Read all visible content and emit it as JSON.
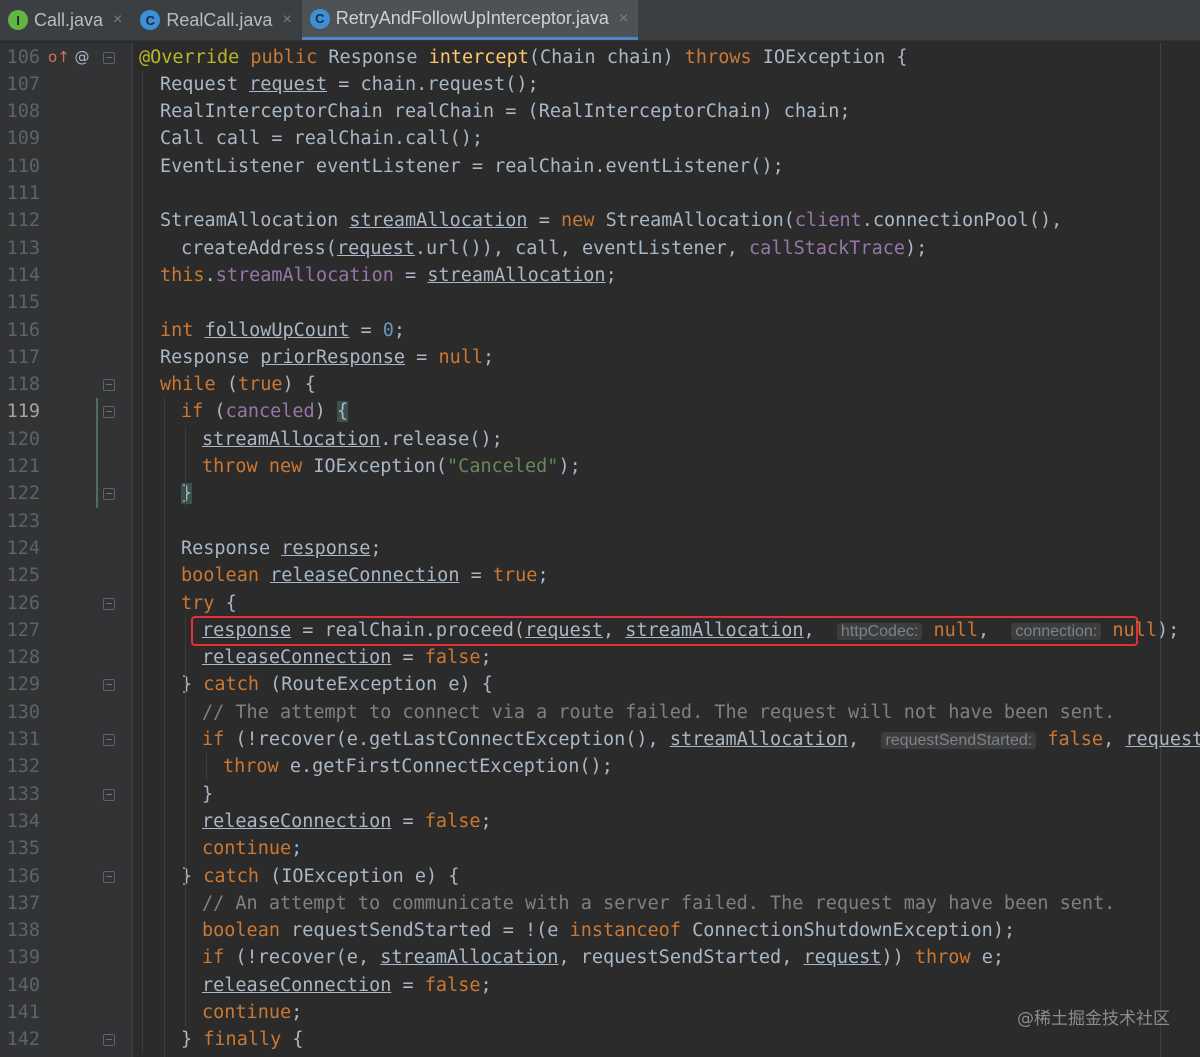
{
  "tabs": [
    {
      "label": "Call.java",
      "icon": "interface-icon",
      "glyph": "I",
      "active": false
    },
    {
      "label": "RealCall.java",
      "icon": "class-icon",
      "glyph": "C",
      "active": false
    },
    {
      "label": "RetryAndFollowUpInterceptor.java",
      "icon": "class-icon",
      "glyph": "C",
      "active": true
    }
  ],
  "tab_close_glyph": "×",
  "current_line": "119",
  "watermark": "@稀土掘金技术社区",
  "highlight_color": "#e5303a",
  "lines": [
    {
      "n": "106",
      "indent": 1,
      "code": [
        [
          "ann",
          "@Override "
        ],
        [
          "kw",
          "public "
        ],
        [
          "",
          "Response "
        ],
        [
          "fn",
          "intercept"
        ],
        [
          "",
          "(Chain chain) "
        ],
        [
          "kw",
          "throws "
        ],
        [
          "",
          "IOException {"
        ]
      ]
    },
    {
      "n": "107",
      "indent": 2,
      "code": [
        [
          "",
          "Request "
        ],
        [
          "u",
          "request"
        ],
        [
          "",
          " = chain.request();"
        ]
      ]
    },
    {
      "n": "108",
      "indent": 2,
      "code": [
        [
          "",
          "RealInterceptorChain realChain = (RealInterceptorChain) chain;"
        ]
      ]
    },
    {
      "n": "109",
      "indent": 2,
      "code": [
        [
          "",
          "Call call = realChain.call();"
        ]
      ]
    },
    {
      "n": "110",
      "indent": 2,
      "code": [
        [
          "",
          "EventListener eventListener = realChain.eventListener();"
        ]
      ]
    },
    {
      "n": "111",
      "indent": 2,
      "code": []
    },
    {
      "n": "112",
      "indent": 2,
      "code": [
        [
          "",
          "StreamAllocation "
        ],
        [
          "u",
          "streamAllocation"
        ],
        [
          "",
          " = "
        ],
        [
          "kw",
          "new "
        ],
        [
          "",
          "StreamAllocation("
        ],
        [
          "fld",
          "client"
        ],
        [
          "",
          ".connectionPool(),"
        ]
      ]
    },
    {
      "n": "113",
      "indent": 3,
      "code": [
        [
          "",
          "createAddress("
        ],
        [
          "u",
          "request"
        ],
        [
          "",
          ".url()), call, eventListener, "
        ],
        [
          "fld",
          "callStackTrace"
        ],
        [
          "",
          ");"
        ]
      ]
    },
    {
      "n": "114",
      "indent": 2,
      "code": [
        [
          "kw",
          "this"
        ],
        [
          "",
          "."
        ],
        [
          "fld",
          "streamAllocation"
        ],
        [
          "",
          " = "
        ],
        [
          "u",
          "streamAllocation"
        ],
        [
          "",
          ";"
        ]
      ]
    },
    {
      "n": "115",
      "indent": 2,
      "code": []
    },
    {
      "n": "116",
      "indent": 2,
      "code": [
        [
          "kw",
          "int "
        ],
        [
          "u",
          "followUpCount"
        ],
        [
          "",
          " = "
        ],
        [
          "num",
          "0"
        ],
        [
          "",
          ";"
        ]
      ]
    },
    {
      "n": "117",
      "indent": 2,
      "code": [
        [
          "",
          "Response "
        ],
        [
          "u",
          "priorResponse"
        ],
        [
          "",
          " = "
        ],
        [
          "kw",
          "null"
        ],
        [
          "",
          ";"
        ]
      ]
    },
    {
      "n": "118",
      "indent": 2,
      "code": [
        [
          "kw",
          "while "
        ],
        [
          "",
          "("
        ],
        [
          "kw",
          "true"
        ],
        [
          "",
          ") {"
        ]
      ]
    },
    {
      "n": "119",
      "indent": 3,
      "code": [
        [
          "kw",
          "if "
        ],
        [
          "",
          "("
        ],
        [
          "fld",
          "canceled"
        ],
        [
          ") ",
          ") "
        ],
        [
          "hl",
          "{"
        ]
      ]
    },
    {
      "n": "120",
      "indent": 4,
      "code": [
        [
          "u",
          "streamAllocation"
        ],
        [
          "",
          ".release();"
        ]
      ]
    },
    {
      "n": "121",
      "indent": 4,
      "code": [
        [
          "kw",
          "throw new "
        ],
        [
          "",
          "IOException("
        ],
        [
          "str",
          "\"Canceled\""
        ],
        [
          "",
          ");"
        ]
      ]
    },
    {
      "n": "122",
      "indent": 3,
      "code": [
        [
          "hl",
          "}"
        ]
      ]
    },
    {
      "n": "123",
      "indent": 3,
      "code": []
    },
    {
      "n": "124",
      "indent": 3,
      "code": [
        [
          "",
          "Response "
        ],
        [
          "u",
          "response"
        ],
        [
          "",
          ";"
        ]
      ]
    },
    {
      "n": "125",
      "indent": 3,
      "code": [
        [
          "kw",
          "boolean "
        ],
        [
          "u",
          "releaseConnection"
        ],
        [
          "",
          " = "
        ],
        [
          "kw",
          "true"
        ],
        [
          "",
          ";"
        ]
      ]
    },
    {
      "n": "126",
      "indent": 3,
      "code": [
        [
          "kw",
          "try "
        ],
        [
          "",
          "{"
        ]
      ]
    },
    {
      "n": "127",
      "indent": 4,
      "code": [
        [
          "u",
          "response"
        ],
        [
          "",
          " = realChain.proceed("
        ],
        [
          "u",
          "request"
        ],
        [
          "",
          ", "
        ],
        [
          "u",
          "streamAllocation"
        ],
        [
          "",
          ",  "
        ],
        [
          "hint",
          "httpCodec:"
        ],
        [
          "",
          " "
        ],
        [
          "kw",
          "null"
        ],
        [
          "",
          ",  "
        ],
        [
          "hint",
          "connection:"
        ],
        [
          "",
          " "
        ],
        [
          "kw",
          "null"
        ],
        [
          "",
          ");"
        ]
      ]
    },
    {
      "n": "128",
      "indent": 4,
      "code": [
        [
          "u",
          "releaseConnection"
        ],
        [
          "",
          " = "
        ],
        [
          "kw",
          "false"
        ],
        [
          "",
          ";"
        ]
      ]
    },
    {
      "n": "129",
      "indent": 3,
      "code": [
        [
          "",
          "} "
        ],
        [
          "kw",
          "catch "
        ],
        [
          "",
          "(RouteException e) {"
        ]
      ]
    },
    {
      "n": "130",
      "indent": 4,
      "code": [
        [
          "cmt",
          "// The attempt to connect via a route failed. The request will not have been sent."
        ]
      ]
    },
    {
      "n": "131",
      "indent": 4,
      "code": [
        [
          "kw",
          "if "
        ],
        [
          "",
          "(!recover(e.getLastConnectException(), "
        ],
        [
          "u",
          "streamAllocation"
        ],
        [
          "",
          ",  "
        ],
        [
          "hint",
          "requestSendStarted:"
        ],
        [
          "",
          " "
        ],
        [
          "kw",
          "false"
        ],
        [
          "",
          ", "
        ],
        [
          "u",
          "request"
        ],
        [
          "",
          ")) {"
        ]
      ]
    },
    {
      "n": "132",
      "indent": 5,
      "code": [
        [
          "kw",
          "throw "
        ],
        [
          "",
          "e.getFirstConnectException();"
        ]
      ]
    },
    {
      "n": "133",
      "indent": 4,
      "code": [
        [
          "",
          "}"
        ]
      ]
    },
    {
      "n": "134",
      "indent": 4,
      "code": [
        [
          "u",
          "releaseConnection"
        ],
        [
          "",
          " = "
        ],
        [
          "kw",
          "false"
        ],
        [
          "",
          ";"
        ]
      ]
    },
    {
      "n": "135",
      "indent": 4,
      "code": [
        [
          "kw",
          "continue"
        ],
        [
          "",
          ";"
        ]
      ]
    },
    {
      "n": "136",
      "indent": 3,
      "code": [
        [
          "",
          "} "
        ],
        [
          "kw",
          "catch "
        ],
        [
          "",
          "(IOException e) {"
        ]
      ]
    },
    {
      "n": "137",
      "indent": 4,
      "code": [
        [
          "cmt",
          "// An attempt to communicate with a server failed. The request may have been sent."
        ]
      ]
    },
    {
      "n": "138",
      "indent": 4,
      "code": [
        [
          "kw",
          "boolean "
        ],
        [
          "",
          "requestSendStarted = !(e "
        ],
        [
          "kw",
          "instanceof "
        ],
        [
          "",
          "ConnectionShutdownException);"
        ]
      ]
    },
    {
      "n": "139",
      "indent": 4,
      "code": [
        [
          "kw",
          "if "
        ],
        [
          "",
          "(!recover(e, "
        ],
        [
          "u",
          "streamAllocation"
        ],
        [
          "",
          ", requestSendStarted, "
        ],
        [
          "u",
          "request"
        ],
        [
          "",
          ")) "
        ],
        [
          "kw",
          "throw "
        ],
        [
          "",
          "e;"
        ]
      ]
    },
    {
      "n": "140",
      "indent": 4,
      "code": [
        [
          "u",
          "releaseConnection"
        ],
        [
          "",
          " = "
        ],
        [
          "kw",
          "false"
        ],
        [
          "",
          ";"
        ]
      ]
    },
    {
      "n": "141",
      "indent": 4,
      "code": [
        [
          "kw",
          "continue"
        ],
        [
          "",
          ";"
        ]
      ]
    },
    {
      "n": "142",
      "indent": 3,
      "code": [
        [
          "",
          "} "
        ],
        [
          "kw",
          "finally "
        ],
        [
          "",
          "{"
        ]
      ]
    }
  ]
}
